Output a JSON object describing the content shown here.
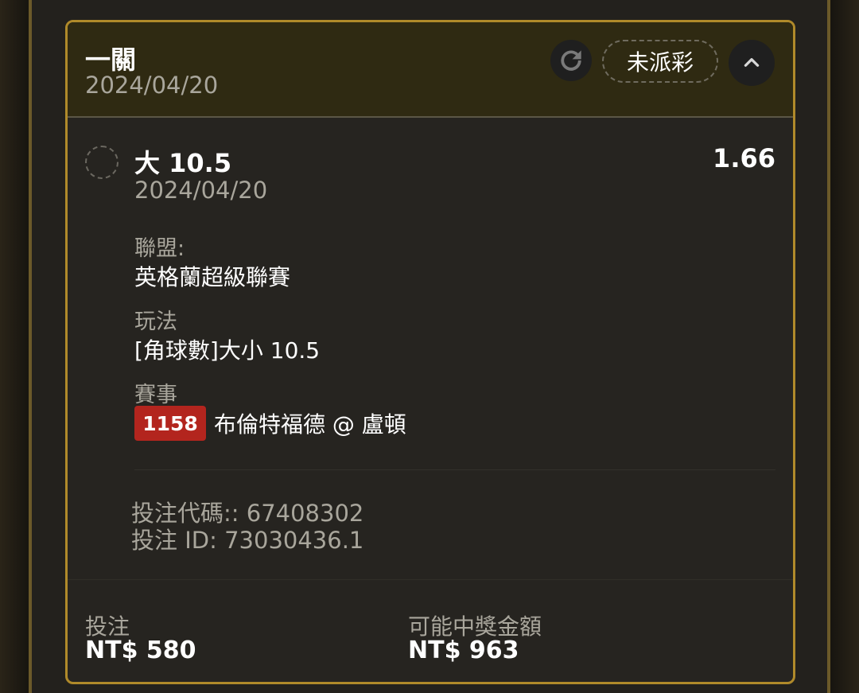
{
  "bet_card": {
    "title": "一關",
    "date": "2024/04/20",
    "status_label": "未派彩",
    "icons": {
      "refresh": "refresh-icon",
      "collapse": "chevron-up-icon"
    }
  },
  "selection": {
    "name": "大 10.5",
    "odds": "1.66",
    "date": "2024/04/20",
    "league_label": "聯盟:",
    "league": "英格蘭超級聯賽",
    "market_label": "玩法",
    "market": "[角球數]大小 10.5",
    "match_label": "賽事",
    "match_id": "1158",
    "match_name": "布倫特福德 @ 盧頓"
  },
  "codes": {
    "bet_code": "投注代碼:: 67408302",
    "bet_id": "投注 ID: 73030436.1"
  },
  "footer": {
    "stake_label": "投注",
    "stake_value": "NT$ 580",
    "payout_label": "可能中獎金額",
    "payout_value": "NT$ 963"
  },
  "colors": {
    "accent_border": "#b08a2a",
    "header_bg": "#2f2a12",
    "badge_red": "#b3251e"
  }
}
